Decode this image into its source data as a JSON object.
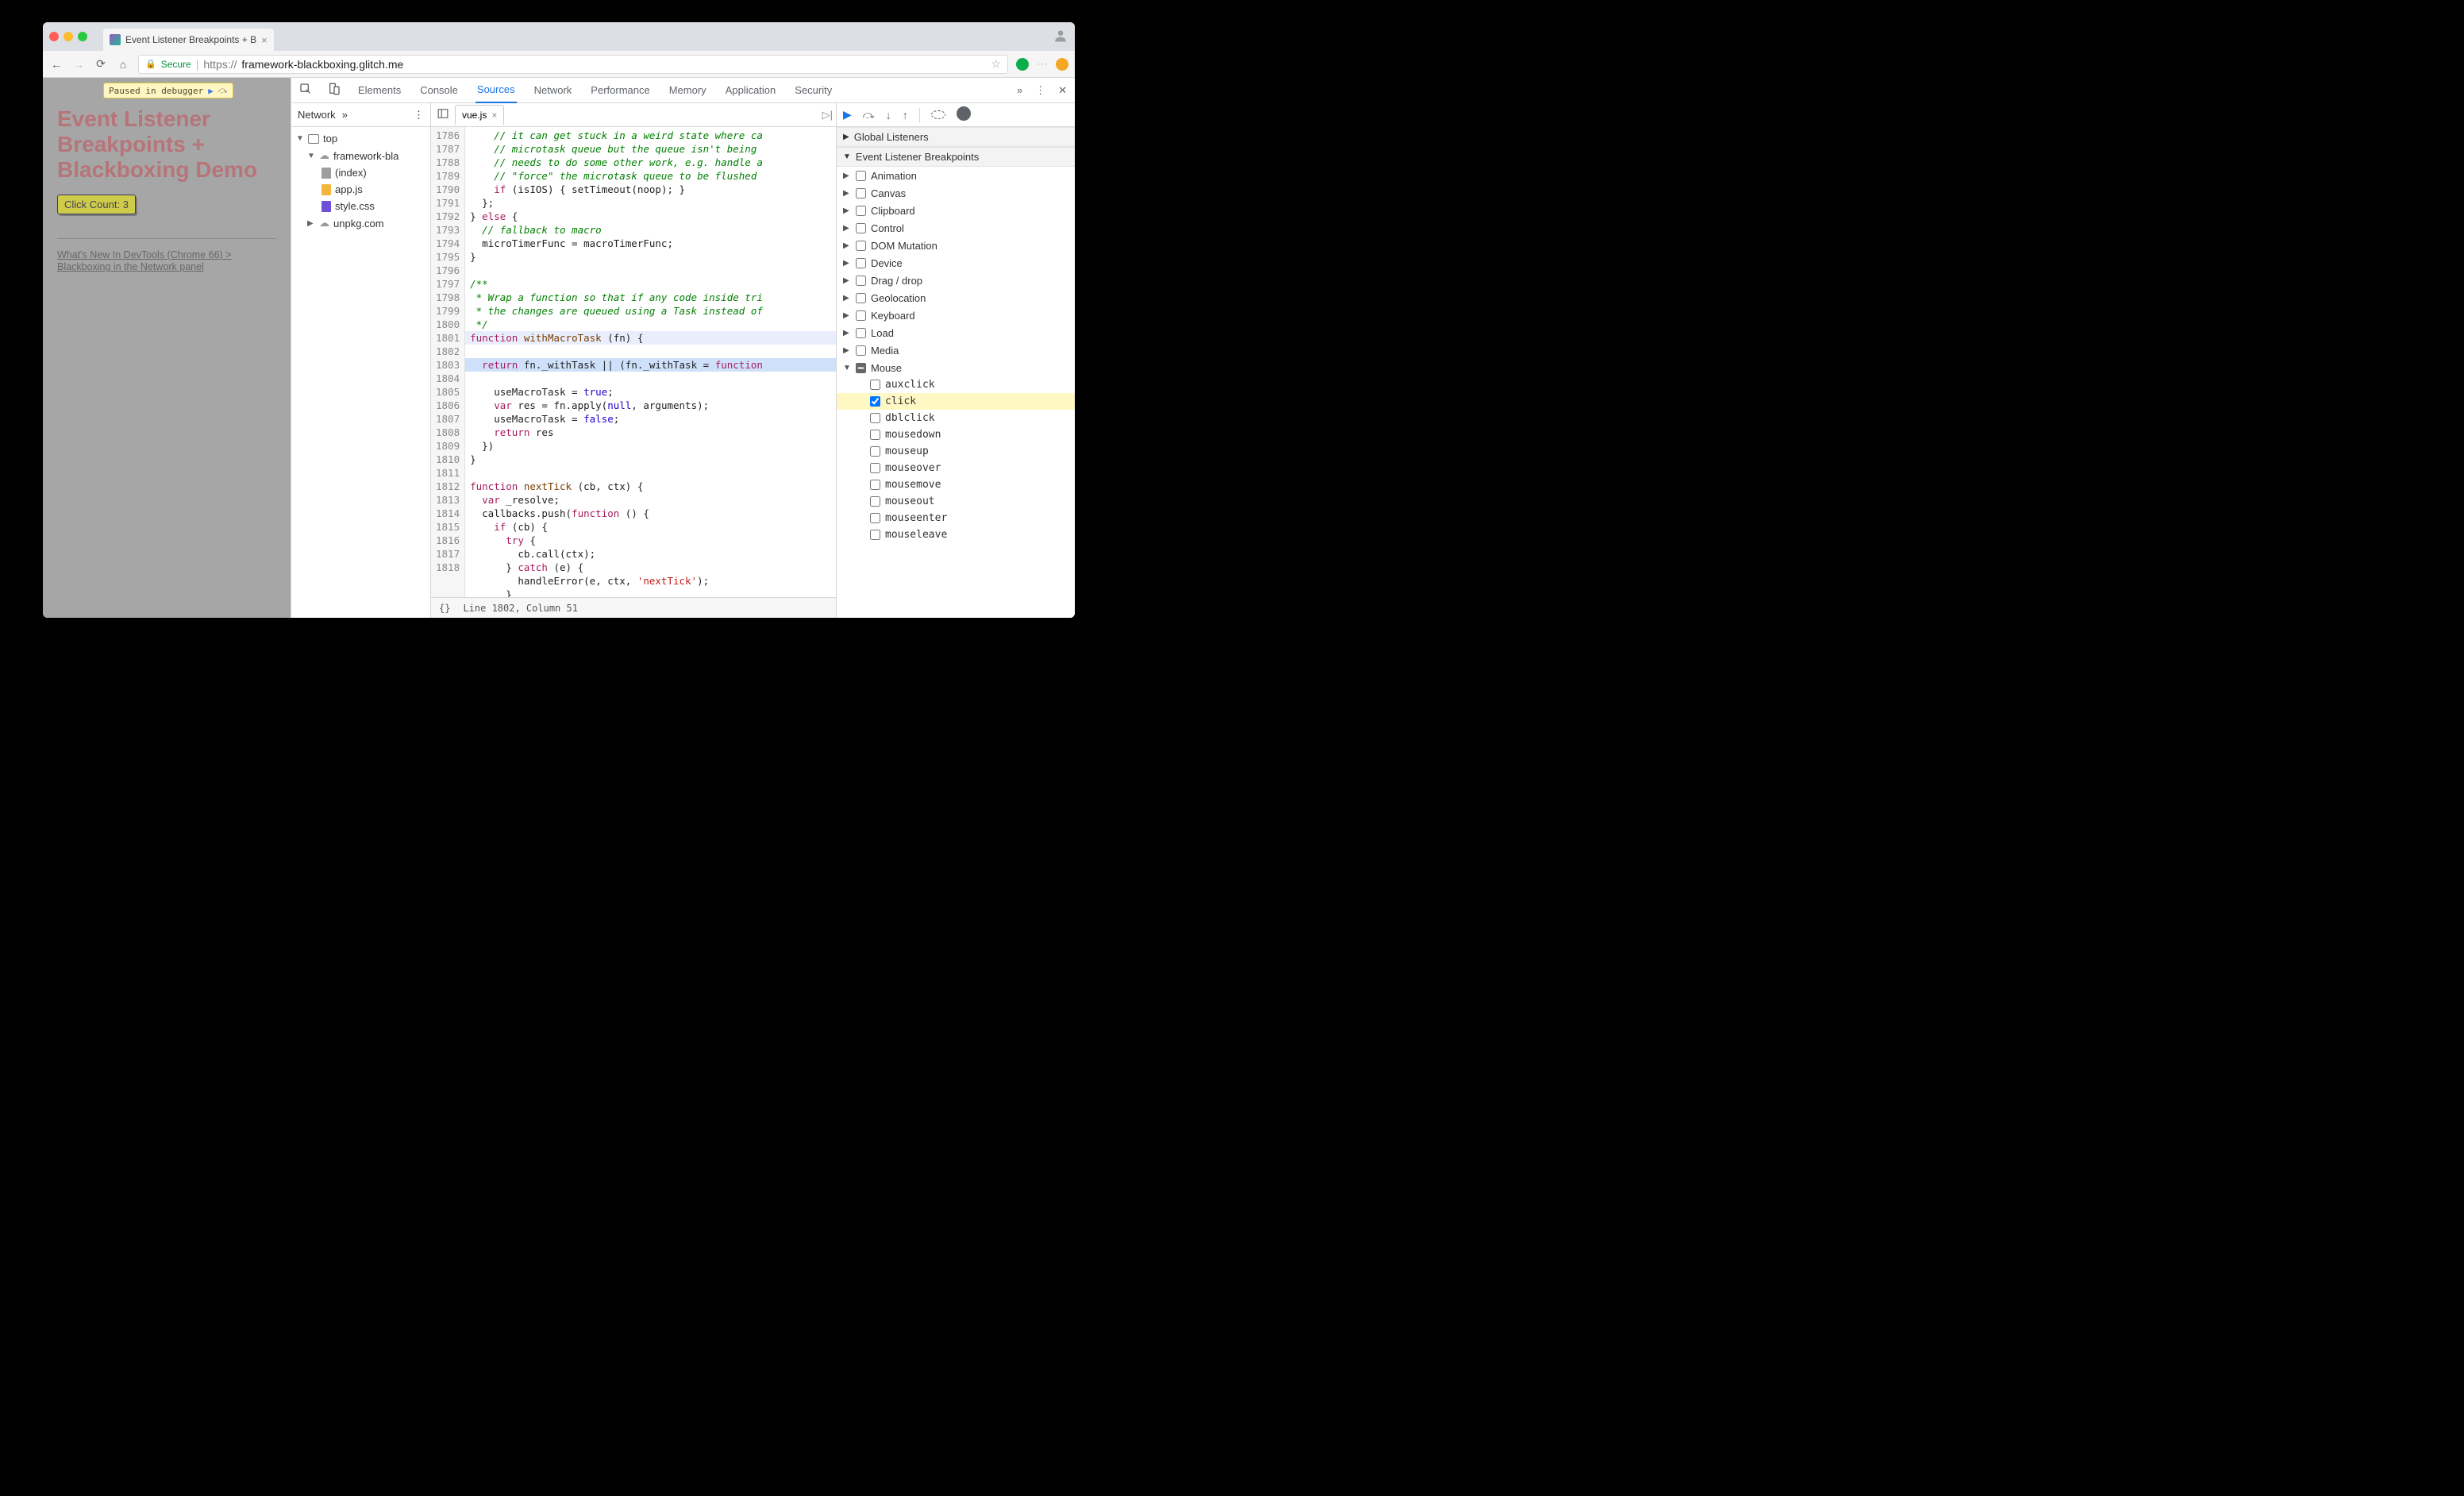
{
  "browser_tab": {
    "title": "Event Listener Breakpoints + B"
  },
  "omnibox": {
    "secure_label": "Secure",
    "host": "https://framework-blackboxing.glitch.me",
    "host_display_strong": "framework-blackboxing.glitch.me",
    "host_display_prefix": "https://"
  },
  "page": {
    "paused_label": "Paused in debugger",
    "heading": "Event Listener Breakpoints + Blackboxing Demo",
    "button_label": "Click Count: 3",
    "link_text": "What's New In DevTools (Chrome 66) > Blackboxing in the Network panel"
  },
  "devtools": {
    "panels": [
      "Elements",
      "Console",
      "Sources",
      "Network",
      "Performance",
      "Memory",
      "Application",
      "Security"
    ],
    "active_panel": "Sources",
    "nav_tab": "Network",
    "tree": {
      "top": "top",
      "domain": "framework-bla",
      "files": {
        "index": "(index)",
        "app": "app.js",
        "style": "style.css"
      },
      "external": "unpkg.com"
    },
    "open_file": "vue.js",
    "line_numbers": [
      1786,
      1787,
      1788,
      1789,
      1790,
      1791,
      1792,
      1793,
      1794,
      1795,
      1796,
      1797,
      1798,
      1799,
      1800,
      1801,
      1802,
      1803,
      1804,
      1805,
      1806,
      1807,
      1808,
      1809,
      1810,
      1811,
      1812,
      1813,
      1814,
      1815,
      1816,
      1817,
      1818
    ],
    "code_lines": [
      {
        "t": "    // it can get stuck in a weird state where ca",
        "cls": "cm"
      },
      {
        "t": "    // microtask queue but the queue isn't being ",
        "cls": "cm"
      },
      {
        "t": "    // needs to do some other work, e.g. handle a",
        "cls": "cm"
      },
      {
        "t": "    // \"force\" the microtask queue to be flushed",
        "cls": "cm"
      },
      {
        "html": "    <span class='kw'>if</span> (isIOS) { setTimeout(noop); }"
      },
      {
        "t": "  };"
      },
      {
        "html": "} <span class='kw'>else</span> {"
      },
      {
        "t": "  // fallback to macro",
        "cls": "cm"
      },
      {
        "t": "  microTimerFunc = macroTimerFunc;"
      },
      {
        "t": "}"
      },
      {
        "t": ""
      },
      {
        "t": "/**",
        "cls": "cm"
      },
      {
        "t": " * Wrap a function so that if any code inside tri",
        "cls": "cm"
      },
      {
        "t": " * the changes are queued using a Task instead of",
        "cls": "cm"
      },
      {
        "t": " */",
        "cls": "cm"
      },
      {
        "html": "<span class='kw'>function</span> <span class='fn'>withMacroTask</span> (fn) {",
        "hl": "fn"
      },
      {
        "html": "  <span class='kw'>return</span> fn._withTask || (fn._withTask = <span class='kw'>function</span>",
        "hl": "cur"
      },
      {
        "html": "    useMacroTask = <span class='lit'>true</span>;"
      },
      {
        "html": "    <span class='kw'>var</span> res = fn.apply(<span class='lit'>null</span>, arguments);"
      },
      {
        "html": "    useMacroTask = <span class='lit'>false</span>;"
      },
      {
        "html": "    <span class='kw'>return</span> res"
      },
      {
        "t": "  })"
      },
      {
        "t": "}"
      },
      {
        "t": ""
      },
      {
        "html": "<span class='kw'>function</span> <span class='fn'>nextTick</span> (cb, ctx) {"
      },
      {
        "html": "  <span class='kw'>var</span> _resolve;"
      },
      {
        "html": "  callbacks.push(<span class='kw'>function</span> () {"
      },
      {
        "html": "    <span class='kw'>if</span> (cb) {"
      },
      {
        "html": "      <span class='kw'>try</span> {"
      },
      {
        "t": "        cb.call(ctx);"
      },
      {
        "html": "      } <span class='kw'>catch</span> (e) {"
      },
      {
        "html": "        handleError(e, ctx, <span class='str'>'nextTick'</span>);"
      },
      {
        "t": "      }"
      }
    ],
    "status": {
      "braces": "{}",
      "position": "Line 1802, Column 51"
    },
    "debugger": {
      "sections": {
        "global": "Global Listeners",
        "elb": "Event Listener Breakpoints"
      },
      "categories": [
        "Animation",
        "Canvas",
        "Clipboard",
        "Control",
        "DOM Mutation",
        "Device",
        "Drag / drop",
        "Geolocation",
        "Keyboard",
        "Load",
        "Media"
      ],
      "mouse_label": "Mouse",
      "mouse_events": [
        "auxclick",
        "click",
        "dblclick",
        "mousedown",
        "mouseup",
        "mouseover",
        "mousemove",
        "mouseout",
        "mouseenter",
        "mouseleave"
      ],
      "checked_event": "click"
    }
  }
}
